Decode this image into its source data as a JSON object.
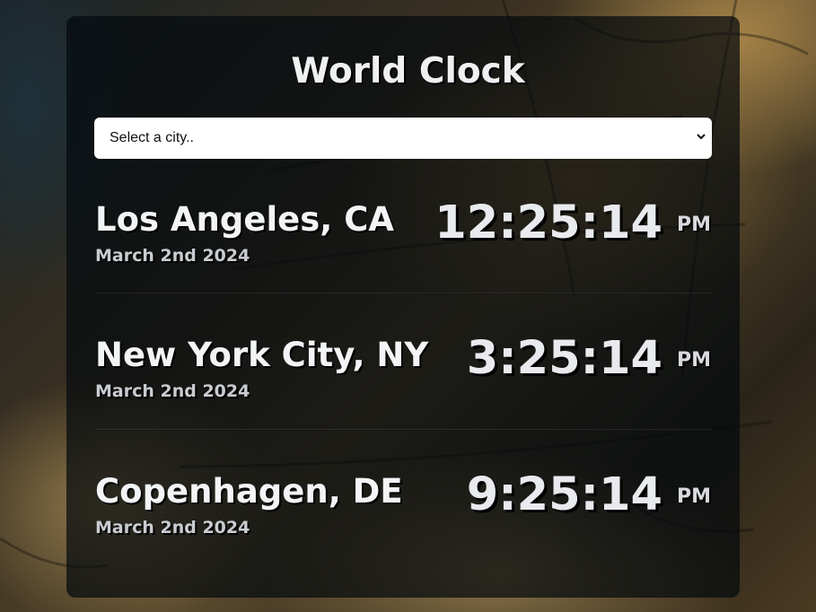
{
  "app": {
    "title": "World Clock"
  },
  "city_select": {
    "selected_label": "Select a city.."
  },
  "clocks": [
    {
      "city": "Los Angeles, CA",
      "date": "March 2nd 2024",
      "time": "12:25:14",
      "ampm": "PM"
    },
    {
      "city": "New York City, NY",
      "date": "March 2nd 2024",
      "time": "3:25:14",
      "ampm": "PM"
    },
    {
      "city": "Copenhagen, DE",
      "date": "March 2nd 2024",
      "time": "9:25:14",
      "ampm": "PM"
    }
  ],
  "colors": {
    "panel_background": "#040a0e",
    "text_primary": "#f2f4f6",
    "text_secondary": "#c9ccd0",
    "select_background": "#ffffff"
  }
}
